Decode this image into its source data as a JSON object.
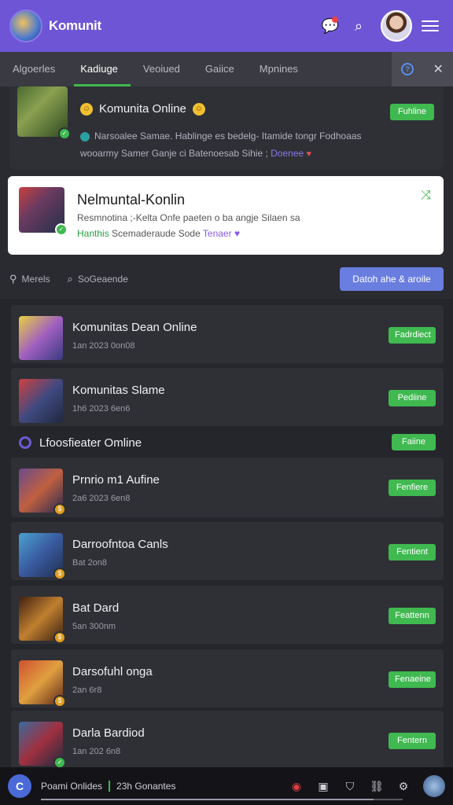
{
  "header": {
    "app_title": "Komunit",
    "logo_icon": "app-logo-icon",
    "chat_icon": "chat-bubble-icon",
    "search_icon": "search-icon",
    "menu_icon": "hamburger-menu-icon"
  },
  "tabs": [
    {
      "label": "Algoerles"
    },
    {
      "label": "Kadiuge"
    },
    {
      "label": "Veoiued"
    },
    {
      "label": "Gaiice"
    },
    {
      "label": "Mpnines"
    }
  ],
  "active_tab": "Kadiuge",
  "featured": [
    {
      "title": "Komunita Online",
      "line1": "Narsoalee Samae. Hablinge es bedelg- Itamide tongr Fodhoaas",
      "line2_a": "wooarmy Samer Ganje ci Batenoesab Sihie ;",
      "line2_link": "Doenee",
      "status": "Fuhline"
    },
    {
      "title": "Nelmuntal-Konlin",
      "line1": "Resmnotina ;-Kelta Onfe paeten o ba angje Silaen sa",
      "line2_green": "Hanthis",
      "line2_text": "Scemaderaude Sode",
      "line2_purple": "Tenaer"
    }
  ],
  "filter": {
    "item1": "Merels",
    "item2": "SoGeaende",
    "button": "Datoh ahe & aroile"
  },
  "list": [
    {
      "name": "Komunitas Dean Online",
      "meta": "1an 2023 0on08",
      "status": "Fadrdiect"
    },
    {
      "name": "Komunitas Slame",
      "meta": "1h6 2023 6en6",
      "status": "Pediine"
    }
  ],
  "section": {
    "title": "Lfoosfieater Omline",
    "status": "Faiine"
  },
  "list2": [
    {
      "name": "Prnrio m1 Aufine",
      "meta": "2a6 2023 6en8",
      "status": "Fenfiere"
    },
    {
      "name": "Darroofntoa Canls",
      "meta": "Bat 2on8",
      "status": "Fentient"
    },
    {
      "name": "Bat Dard",
      "meta": "5an 300nm",
      "status": "Feattenn"
    },
    {
      "name": "Darsofuhl onga",
      "meta": "2an 6r8",
      "status": "Fenaeine"
    },
    {
      "name": "Darla Bardiod",
      "meta": "1an 202 6n8",
      "status": "Fentern"
    }
  ],
  "bottom_bar": {
    "logo_letter": "C",
    "text1": "Poami Onlides",
    "text2": "23h Gonantes",
    "progress": 0.92
  },
  "colors": {
    "accent": "#6e55d6",
    "online_green": "#3fb950",
    "button_blue": "#6a7ee0"
  }
}
